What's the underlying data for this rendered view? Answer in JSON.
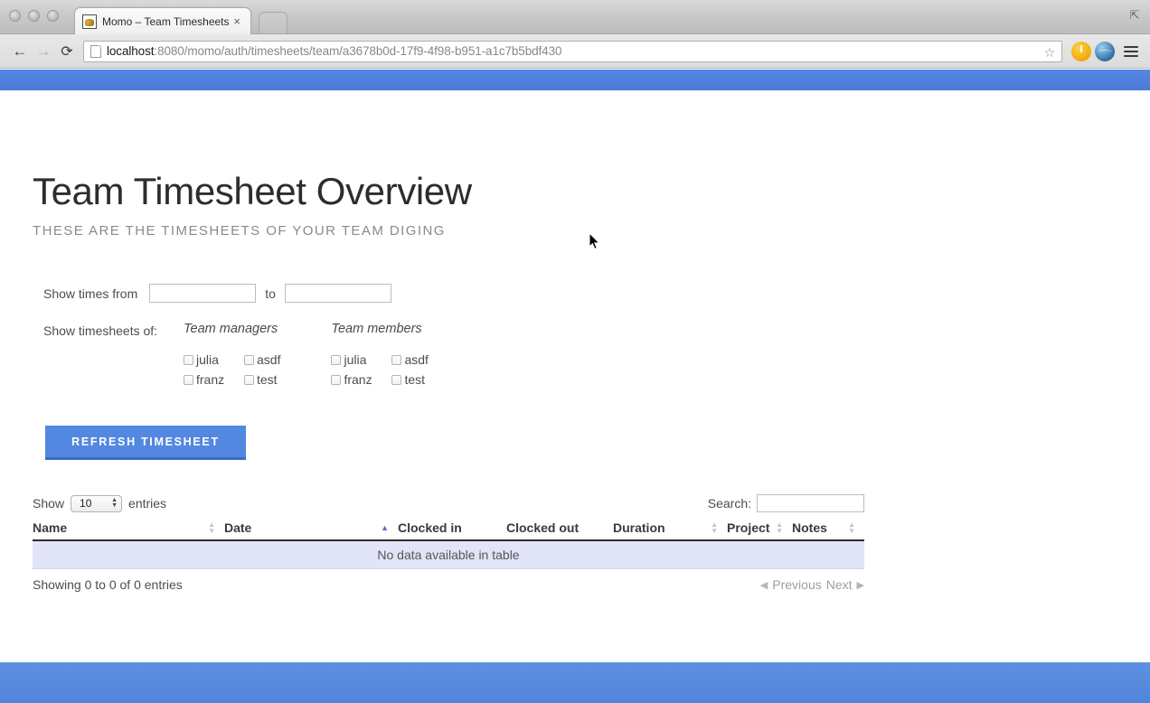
{
  "browser": {
    "window_buttons": [
      "close",
      "minimize",
      "maximize"
    ],
    "tab": {
      "title": "Momo – Team Timesheets",
      "close_label": "×",
      "favicon_name": "momo-favicon"
    },
    "new_tab_label": "",
    "restore_label": "⇱",
    "nav": {
      "back_label": "←",
      "forward_label": "→",
      "reload_label": "⟳"
    },
    "url": {
      "host": "localhost",
      "rest": ":8080/momo/auth/timesheets/team/a3678b0d-17f9-4f98-b951-a1c7b5bdf430",
      "full": "localhost:8080/momo/auth/timesheets/team/a3678b0d-17f9-4f98-b951-a1c7b5bdf430"
    },
    "star_label": "☆",
    "extensions": [
      "lastpass-icon",
      "globe-icon"
    ],
    "menu_label": "menu"
  },
  "page": {
    "title": "Team Timesheet Overview",
    "subtitle": "THESE ARE THE TIMESHEETS OF YOUR TEAM DIGING",
    "accent_color": "#5288e0",
    "topbar_color": "#4f81de",
    "footer_color": "#5a8ddf"
  },
  "filters": {
    "times_label": "Show times from",
    "to_label": "to",
    "date_from_value": "",
    "date_to_value": "",
    "date_from_placeholder": "",
    "date_to_placeholder": "",
    "timesheets_label": "Show timesheets of:",
    "groups": [
      {
        "title": "Team managers",
        "options": [
          {
            "label": "julia",
            "checked": false
          },
          {
            "label": "asdf",
            "checked": false
          },
          {
            "label": "franz",
            "checked": false
          },
          {
            "label": "test",
            "checked": false
          }
        ]
      },
      {
        "title": "Team members",
        "options": [
          {
            "label": "julia",
            "checked": false
          },
          {
            "label": "asdf",
            "checked": false
          },
          {
            "label": "franz",
            "checked": false
          },
          {
            "label": "test",
            "checked": false
          }
        ]
      }
    ],
    "refresh_button": "REFRESH TIMESHEET"
  },
  "table": {
    "show_prefix": "Show",
    "show_suffix": "entries",
    "length_value": "10",
    "length_options": [
      "10",
      "25",
      "50",
      "100"
    ],
    "search_label": "Search:",
    "search_value": "",
    "search_placeholder": "",
    "columns": [
      {
        "label": "Name",
        "sort": "both"
      },
      {
        "label": "Date",
        "sort": "asc"
      },
      {
        "label": "Clocked in",
        "sort": "none"
      },
      {
        "label": "Clocked out",
        "sort": "none"
      },
      {
        "label": "Duration",
        "sort": "both"
      },
      {
        "label": "Project",
        "sort": "both"
      },
      {
        "label": "Notes",
        "sort": "both"
      }
    ],
    "empty_message": "No data available in table",
    "info_text": "Showing 0 to 0 of 0 entries",
    "previous_label": "Previous",
    "next_label": "Next",
    "sort_asc_glyph": "▲",
    "sort_both_glyph_up": "▲",
    "sort_both_glyph_down": "▼",
    "prev_arrow": "◀",
    "next_arrow": "▶",
    "rows": []
  }
}
